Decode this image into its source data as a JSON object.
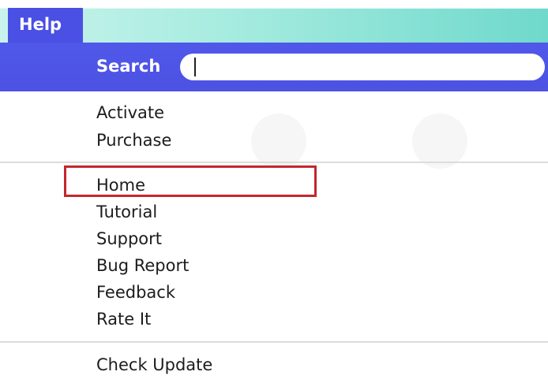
{
  "menubar": {
    "title": "Help"
  },
  "search": {
    "label": "Search",
    "value": ""
  },
  "groups": {
    "license": [
      "Activate",
      "Purchase"
    ],
    "help": [
      "Home",
      "Tutorial",
      "Support",
      "Bug Report",
      "Feedback",
      "Rate It"
    ],
    "update": [
      "Check Update"
    ]
  },
  "highlighted_item": "Home",
  "colors": {
    "menu_accent": "#4a50e4",
    "menubar_gradient": "#a8ece0",
    "highlight_box": "#c4262e"
  }
}
